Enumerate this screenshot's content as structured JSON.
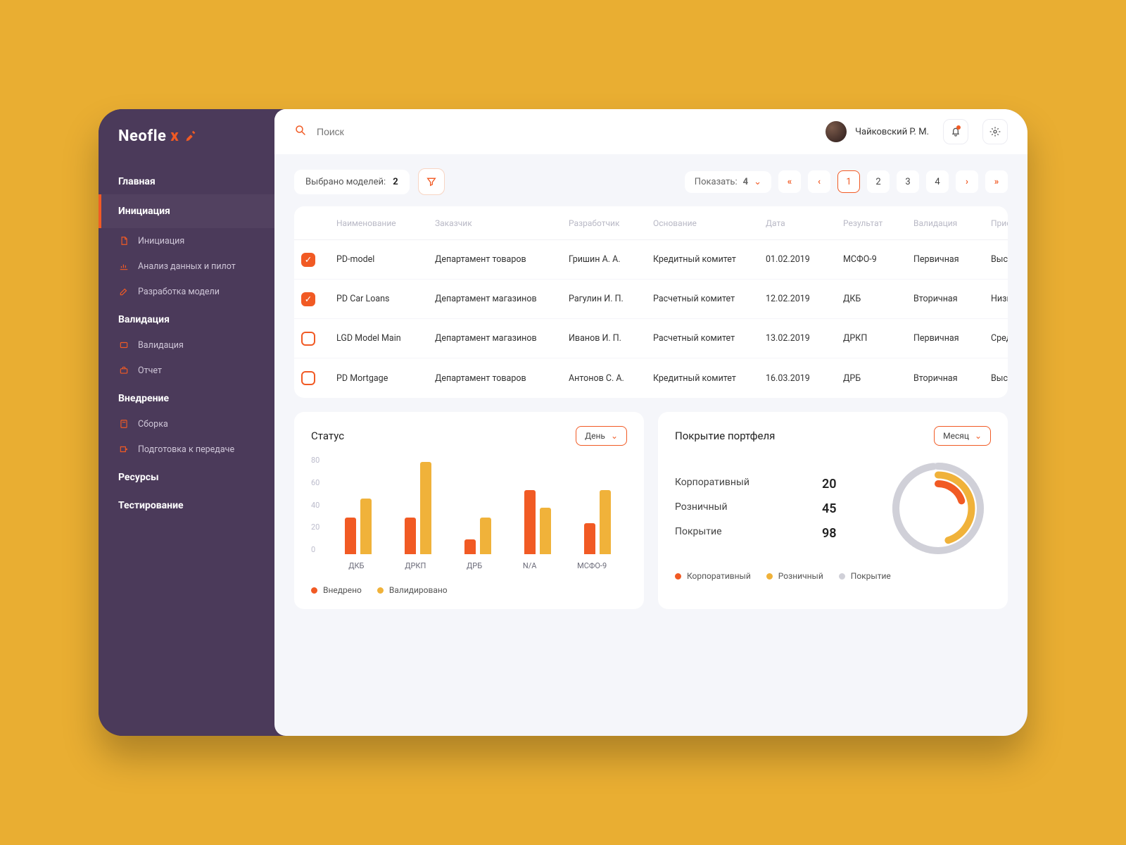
{
  "brand": {
    "name_part1": "Neofle",
    "name_part2": "x"
  },
  "sidebar": {
    "section1": {
      "title": "Главная"
    },
    "section2": {
      "title": "Инициация",
      "items": [
        {
          "icon": "file-icon",
          "label": "Инициация"
        },
        {
          "icon": "analysis-icon",
          "label": "Анализ данных и пилот"
        },
        {
          "icon": "edit-icon",
          "label": "Разработка модели"
        }
      ]
    },
    "section3": {
      "title": "Валидация",
      "items": [
        {
          "icon": "badge-icon",
          "label": "Валидация"
        },
        {
          "icon": "briefcase-icon",
          "label": "Отчет"
        }
      ]
    },
    "section4": {
      "title": "Внедрение",
      "items": [
        {
          "icon": "calc-icon",
          "label": "Сборка"
        },
        {
          "icon": "send-icon",
          "label": "Подготовка к передаче"
        }
      ]
    },
    "section5": {
      "title": "Ресурсы"
    },
    "section6": {
      "title": "Тестирование"
    }
  },
  "topbar": {
    "search_placeholder": "Поиск",
    "user_name": "Чайковский Р. М."
  },
  "controls": {
    "selected_label": "Выбрано моделей:",
    "selected_count": "2",
    "show_label": "Показать:",
    "show_value": "4",
    "pages": [
      "1",
      "2",
      "3",
      "4"
    ],
    "active_page": "1"
  },
  "table": {
    "headers": {
      "name": "Наименование",
      "customer": "Заказчик",
      "developer": "Разработчик",
      "basis": "Основание",
      "date": "Дата",
      "result": "Результат",
      "validation": "Валидация",
      "priority": "Приоритет"
    },
    "rows": [
      {
        "checked": true,
        "name": "PD-model",
        "customer": "Департамент товаров",
        "developer": "Гришин А. А.",
        "basis": "Кредитный комитет",
        "date": "01.02.2019",
        "result": "МСФО-9",
        "validation": "Первичная",
        "priority": "Высокий"
      },
      {
        "checked": true,
        "name": "PD Car Loans",
        "customer": "Департамент магазинов",
        "developer": "Рагулин И. П.",
        "basis": "Расчетный комитет",
        "date": "12.02.2019",
        "result": "ДКБ",
        "validation": "Вторичная",
        "priority": "Низкий"
      },
      {
        "checked": false,
        "name": "LGD Model Main",
        "customer": "Департамент магазинов",
        "developer": "Иванов И. П.",
        "basis": "Расчетный комитет",
        "date": "13.02.2019",
        "result": "ДРКП",
        "validation": "Первичная",
        "priority": "Средний"
      },
      {
        "checked": false,
        "name": "PD Mortgage",
        "customer": "Департамент товаров",
        "developer": "Антонов С. А.",
        "basis": "Кредитный комитет",
        "date": "16.03.2019",
        "result": "ДРБ",
        "validation": "Вторичная",
        "priority": "Высокий"
      }
    ]
  },
  "status_card": {
    "title": "Статус",
    "period": "День",
    "legend_a": "Внедрено",
    "legend_b": "Валидировано"
  },
  "coverage_card": {
    "title": "Покрытие портфеля",
    "period": "Месяц",
    "rows": [
      {
        "label": "Корпоративный",
        "value": "20"
      },
      {
        "label": "Розничный",
        "value": "45"
      },
      {
        "label": "Покрытие",
        "value": "98"
      }
    ],
    "legend_a": "Корпоративный",
    "legend_b": "Розничный",
    "legend_c": "Покрытие"
  },
  "chart_data": [
    {
      "type": "bar",
      "title": "Статус",
      "ylim": [
        0,
        80
      ],
      "yticks": [
        0,
        20,
        40,
        60,
        80
      ],
      "categories": [
        "ДКБ",
        "ДРКП",
        "ДРБ",
        "N/A",
        "МСФО-9"
      ],
      "series": [
        {
          "name": "Внедрено",
          "color": "#f15a24",
          "values": [
            30,
            30,
            12,
            52,
            25
          ]
        },
        {
          "name": "Валидировано",
          "color": "#f0b23a",
          "values": [
            45,
            75,
            30,
            38,
            52
          ]
        }
      ]
    },
    {
      "type": "pie",
      "title": "Покрытие портфеля",
      "series": [
        {
          "name": "Корпоративный",
          "value": 20,
          "color": "#f15a24"
        },
        {
          "name": "Розничный",
          "value": 45,
          "color": "#f0b23a"
        },
        {
          "name": "Покрытие",
          "value": 98,
          "color": "#d0d0d8"
        }
      ]
    }
  ]
}
